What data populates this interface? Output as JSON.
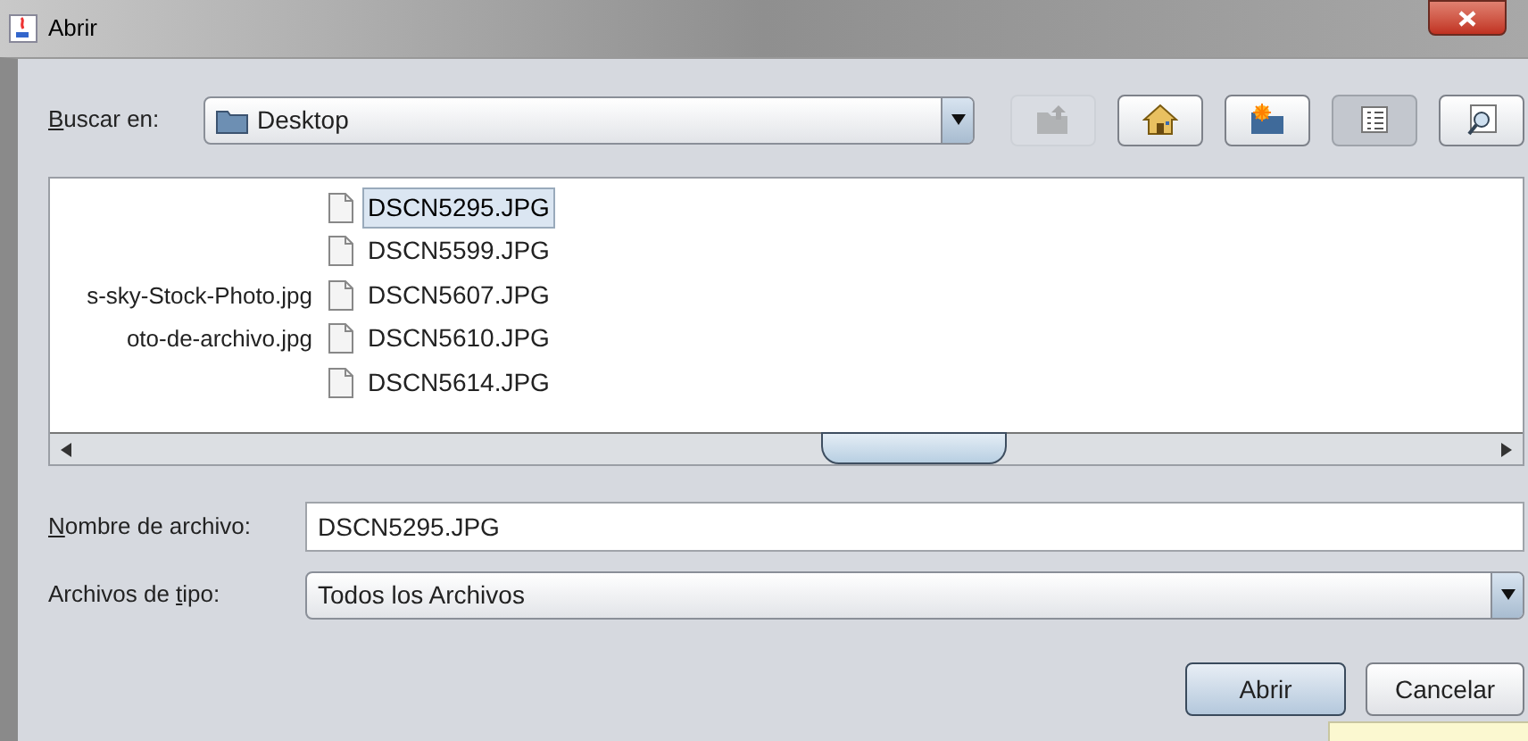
{
  "window": {
    "title": "Abrir"
  },
  "look_in": {
    "mnemonic": "B",
    "label_after": "uscar en:",
    "value": "Desktop"
  },
  "toolbar": [
    {
      "kind": "up",
      "disabled": true,
      "selected": false
    },
    {
      "kind": "home",
      "disabled": false,
      "selected": false
    },
    {
      "kind": "new-folder",
      "disabled": false,
      "selected": false
    },
    {
      "kind": "list",
      "disabled": false,
      "selected": true
    },
    {
      "kind": "details",
      "disabled": false,
      "selected": false
    }
  ],
  "file_list": {
    "columns": [
      [
        {
          "kind": "blank"
        },
        {
          "kind": "blank"
        },
        {
          "name": "s-sky-Stock-Photo.jpg",
          "kind": "cut",
          "selected": false
        },
        {
          "name": "oto-de-archivo.jpg",
          "kind": "cut",
          "selected": false
        }
      ],
      [
        {
          "name": "DSCN5295.JPG",
          "kind": "file",
          "selected": true
        },
        {
          "name": "DSCN5599.JPG",
          "kind": "file",
          "selected": false
        },
        {
          "name": "DSCN5607.JPG",
          "kind": "file",
          "selected": false
        },
        {
          "name": "DSCN5610.JPG",
          "kind": "file",
          "selected": false
        },
        {
          "name": "DSCN5614.JPG",
          "kind": "file",
          "selected": false
        }
      ]
    ]
  },
  "file_name": {
    "mnemonic": "N",
    "label_after": "ombre de archivo:",
    "value": "DSCN5295.JPG"
  },
  "file_type": {
    "label_before": "Archivos de ",
    "mnemonic": "t",
    "label_after": "ipo:",
    "value": "Todos los Archivos"
  },
  "buttons": [
    {
      "label": "Abrir",
      "kind": "default"
    },
    {
      "label": "Cancelar",
      "kind": "normal"
    }
  ]
}
